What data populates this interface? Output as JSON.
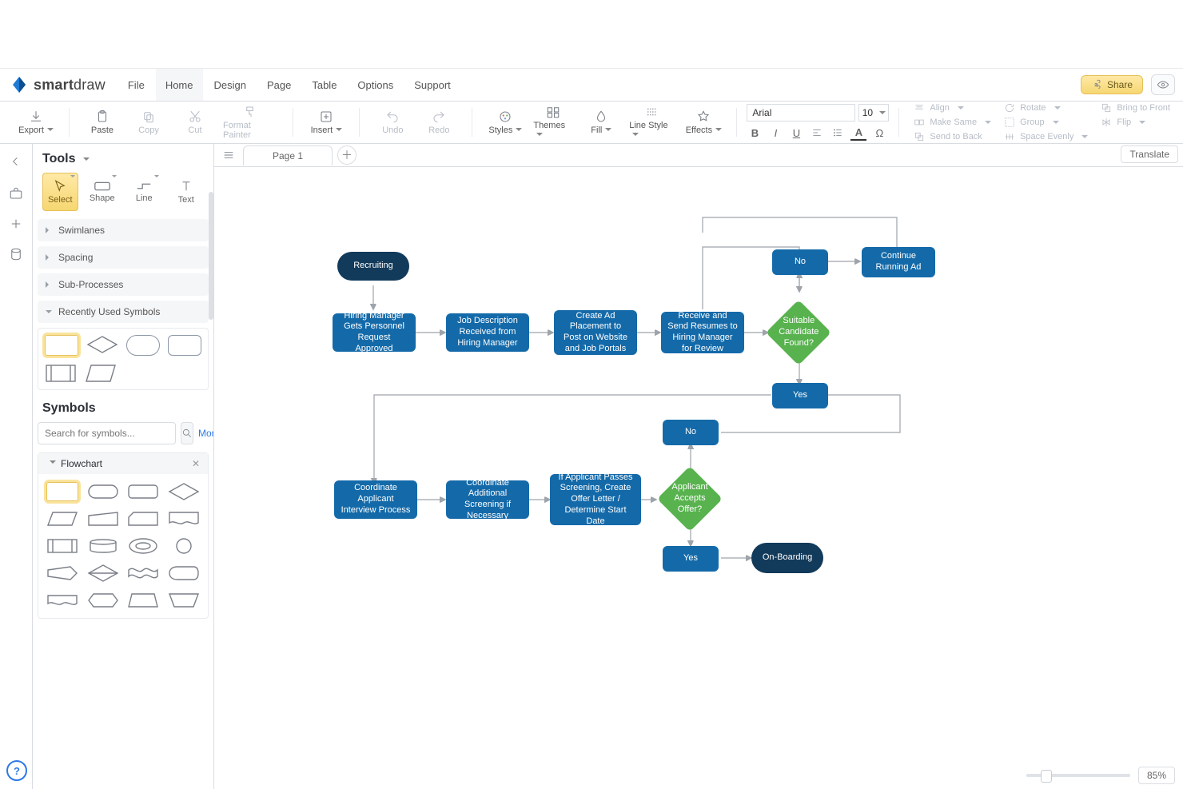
{
  "app": {
    "brand_bold": "smart",
    "brand_thin": "draw"
  },
  "menubar": {
    "items": [
      {
        "label": "File"
      },
      {
        "label": "Home",
        "active": true
      },
      {
        "label": "Design"
      },
      {
        "label": "Page"
      },
      {
        "label": "Table"
      },
      {
        "label": "Options"
      },
      {
        "label": "Support"
      }
    ],
    "share": "Share"
  },
  "ribbon": {
    "export": "Export",
    "paste": "Paste",
    "copy": "Copy",
    "cut": "Cut",
    "format_painter": "Format Painter",
    "insert": "Insert",
    "undo": "Undo",
    "redo": "Redo",
    "styles": "Styles",
    "themes": "Themes",
    "fill": "Fill",
    "line_style": "Line Style",
    "effects": "Effects",
    "align": "Align",
    "rotate": "Rotate",
    "bring_front": "Bring to Front",
    "make_same": "Make Same",
    "group": "Group",
    "flip": "Flip",
    "send_back": "Send to Back",
    "space": "Space Evenly"
  },
  "font": {
    "name": "Arial",
    "size": "10"
  },
  "left": {
    "tools": "Tools",
    "select": "Select",
    "shape": "Shape",
    "line": "Line",
    "text": "Text",
    "swimlanes": "Swimlanes",
    "spacing": "Spacing",
    "subproc": "Sub-Processes",
    "recent": "Recently Used Symbols",
    "symbols": "Symbols",
    "search_ph": "Search for symbols...",
    "more": "More",
    "flowchart": "Flowchart"
  },
  "pages": {
    "page1": "Page 1",
    "translate": "Translate"
  },
  "zoom": "85%",
  "diagram": {
    "recruiting": "Recruiting",
    "hiring_mgr": "Hiring Manager Gets Personnel Request Approved",
    "job_desc": "Job Description Received from Hiring Manager",
    "create_ad": "Create Ad Placement to Post on Website and Job Portals",
    "receive_send": "Receive and Send Resumes to Hiring Manager for Review",
    "suitable": "Suitable Candidate Found?",
    "no1": "No",
    "continue_ad": "Continue Running Ad",
    "yes1": "Yes",
    "coord_interview": "Coordinate Applicant Interview Process",
    "coord_screen": "Coordinate Additional Screening if Necessary",
    "if_pass": "If Applicant Passes Screening, Create Offer Letter / Determine Start Date",
    "accepts": "Applicant Accepts Offer?",
    "no2": "No",
    "yes2": "Yes",
    "onboarding": "On-Boarding"
  }
}
